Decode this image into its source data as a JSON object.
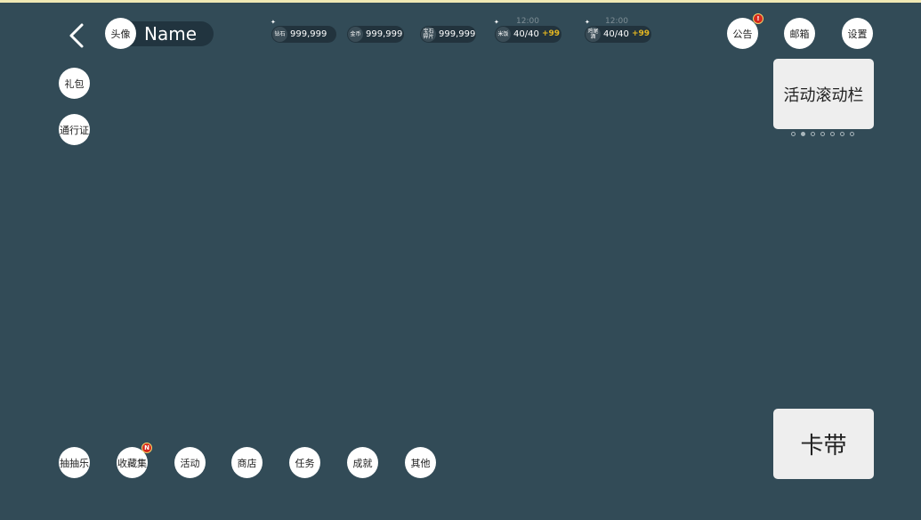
{
  "header": {
    "avatar_label": "头像",
    "player_name": "Name",
    "resources": [
      {
        "icon_label": "钻石",
        "value": "999,999"
      },
      {
        "icon_label": "金币",
        "value": "999,999"
      },
      {
        "icon_label": "宝石\n碎片",
        "value": "999,999"
      },
      {
        "icon_label": "米饭",
        "value": "40/40",
        "plus": "+99",
        "timer": "12:00"
      },
      {
        "icon_label": "鸡尾\n酒",
        "value": "40/40",
        "plus": "+99",
        "timer": "12:00"
      }
    ],
    "buttons": {
      "announcement": "公告",
      "mail": "邮箱",
      "settings": "设置"
    },
    "announcement_badge": "!"
  },
  "left_column": {
    "gift_pack": "礼包",
    "pass": "通行证"
  },
  "activity_banner": {
    "label": "活动滚动栏",
    "page_count": 7,
    "active_index": 1
  },
  "card_band": {
    "label": "卡带"
  },
  "bottom_nav": {
    "items": [
      {
        "label": "抽抽乐"
      },
      {
        "label": "收藏集",
        "badge": "N"
      },
      {
        "label": "活动"
      },
      {
        "label": "商店"
      },
      {
        "label": "任务"
      },
      {
        "label": "成就"
      },
      {
        "label": "其他"
      }
    ]
  },
  "colors": {
    "background": "#324b57",
    "top_accent": "#f0e9b4",
    "pill": "#22333d",
    "plus_text": "#e6b821",
    "badge": "#d6281c"
  },
  "icons": {
    "back": "chevron-left-icon",
    "sparkle": "sparkle-icon"
  }
}
